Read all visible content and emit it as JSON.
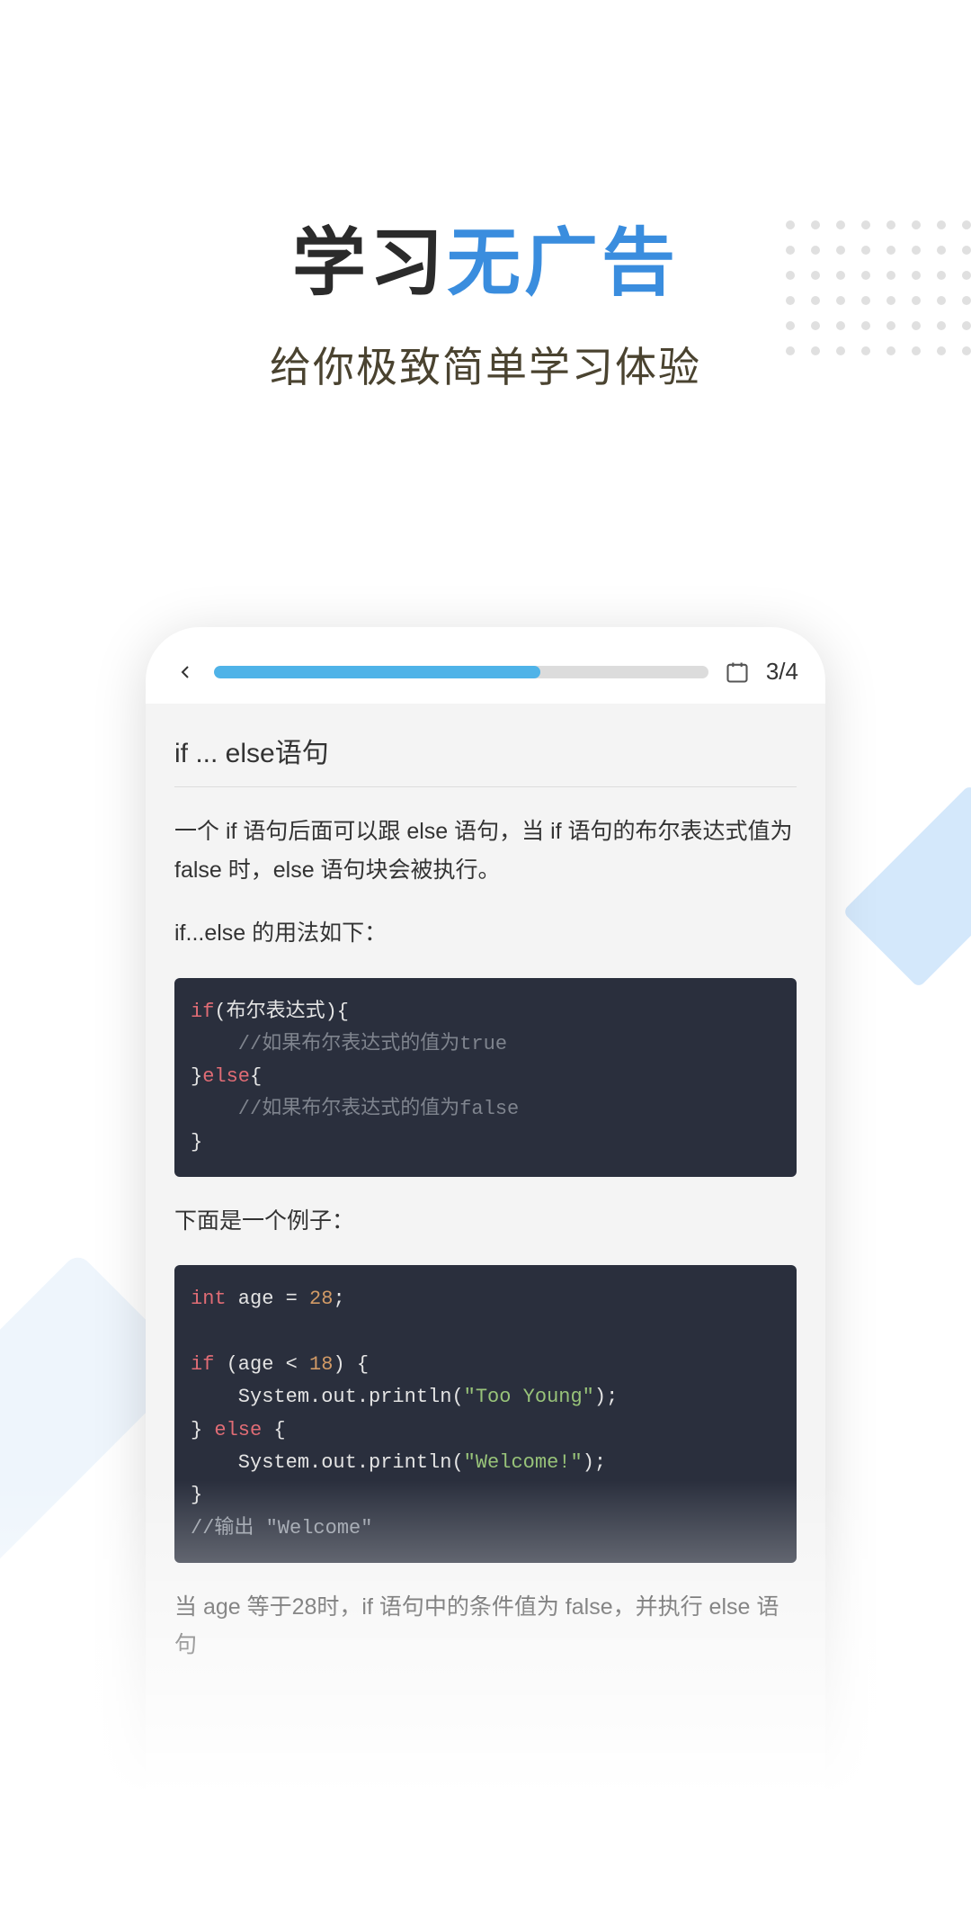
{
  "hero": {
    "title_left": "学习",
    "title_right": "无广告",
    "subtitle": "给你极致简单学习体验"
  },
  "phone": {
    "progress_percent": 66,
    "page_label": "3/4",
    "lesson_title": "if ... else语句",
    "para1": "一个 if 语句后面可以跟 else 语句，当 if 语句的布尔表达式值为 false 时，else 语句块会被执行。",
    "para2": "if...else 的用法如下：",
    "code1": {
      "l1_kw": "if",
      "l1_rest": "(布尔表达式){",
      "l2": "    //如果布尔表达式的值为true",
      "l3a": "}",
      "l3_kw": "else",
      "l3b": "{",
      "l4": "    //如果布尔表达式的值为false",
      "l5": "}"
    },
    "para3": "下面是一个例子：",
    "code2": {
      "l1_kw": "int",
      "l1_rest": " age = ",
      "l1_num": "28",
      "l1_semi": ";",
      "l3_kw": "if",
      "l3_rest": " (age < ",
      "l3_num": "18",
      "l3_close": ") {",
      "l4a": "    System.out.println(",
      "l4_str": "\"Too Young\"",
      "l4b": ");",
      "l5a": "} ",
      "l5_kw": "else",
      "l5b": " {",
      "l6a": "    System.out.println(",
      "l6_str": "\"Welcome!\"",
      "l6b": ");",
      "l7": "}",
      "l8": "//输出 \"Welcome\""
    },
    "para4": "当 age 等于28时，if 语句中的条件值为 false，并执行 else 语句"
  }
}
